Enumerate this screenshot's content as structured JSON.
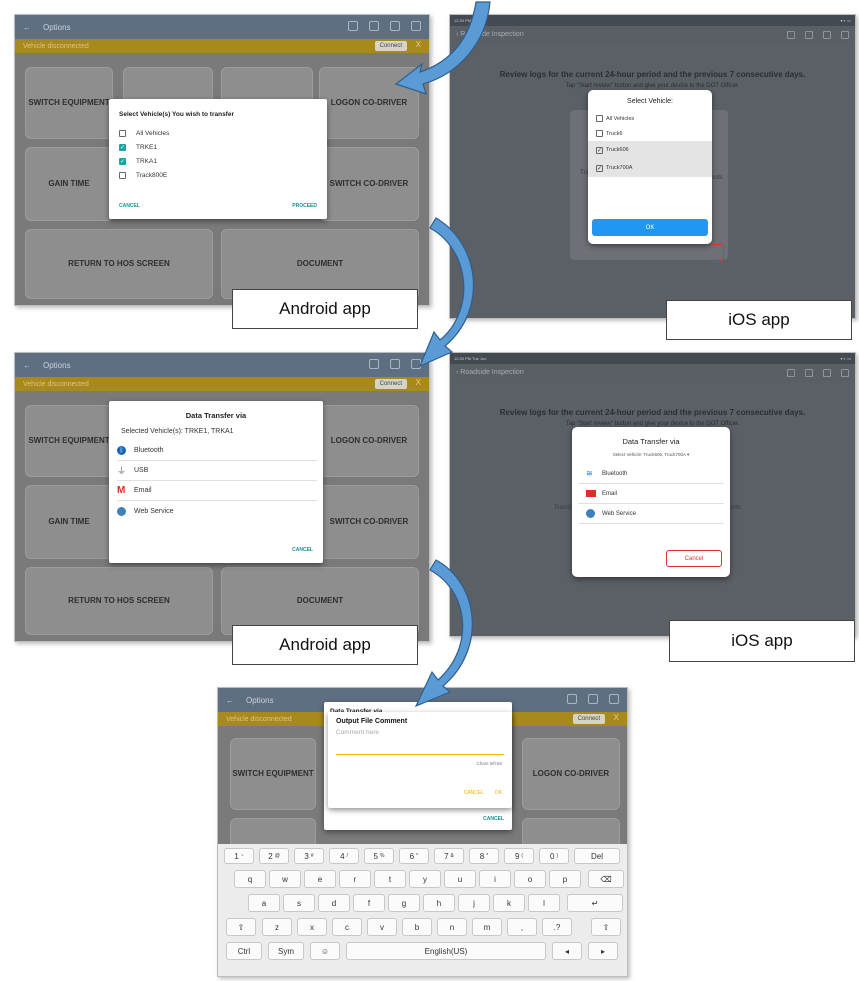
{
  "android": {
    "title": "Options",
    "disconnected": "Vehicle disconnected",
    "connect_label": "Connect",
    "close_x": "X",
    "tiles": {
      "switch_equipment": "SWITCH EQUIPMENT",
      "logon_codriver": "LOGON CO-DRIVER",
      "gain_time": "GAIN TIME",
      "switch_codriver": "SWITCH CO-DRIVER",
      "return_hos": "RETURN TO HOS SCREEN",
      "document": "DOCUMENT"
    },
    "select_dialog": {
      "title": "Select Vehicle(s) You wish to transfer",
      "items": [
        {
          "label": "All Vehicles",
          "checked": false
        },
        {
          "label": "TRKE1",
          "checked": true
        },
        {
          "label": "TRKA1",
          "checked": true
        },
        {
          "label": "Track800E",
          "checked": false
        }
      ],
      "cancel": "CANCEL",
      "proceed": "PROCEED"
    },
    "transfer_dialog": {
      "title": "Data Transfer via",
      "selected": "Selected Vehicle(s): TRKE1, TRKA1",
      "options": [
        {
          "label": "Bluetooth",
          "icon": "bluetooth-icon"
        },
        {
          "label": "USB",
          "icon": "usb-icon"
        },
        {
          "label": "Email",
          "icon": "email-icon"
        },
        {
          "label": "Web Service",
          "icon": "web-service-icon"
        }
      ],
      "cancel": "CANCEL"
    },
    "comment_dialog": {
      "header": "Data Transfer via",
      "title": "Output File Comment",
      "placeholder": "Comment here",
      "chars_left": "Chars left:60",
      "cancel": "CANCEL",
      "ok": "OK",
      "cancel2": "CANCEL"
    }
  },
  "ios": {
    "status_left": "12:30 PM  Tue Jun",
    "back_label": "Roadside Inspection",
    "review_text": "Review logs for the current 24-hour period and the previous 7 consecutive days.",
    "tap_text": "Tap \"Start review\" button and give your device to the DOT Officer.",
    "select_dialog": {
      "title": "Select Vehicle:",
      "items": [
        {
          "label": "All Vehicles",
          "checked": false
        },
        {
          "label": "Truck6",
          "checked": false
        },
        {
          "label": "Truck606",
          "checked": true
        },
        {
          "label": "Truck700A",
          "checked": true
        }
      ],
      "ok": "OK"
    },
    "transfer_dialog": {
      "title": "Data Transfer via",
      "selected": "Select Vehicle: Truck606, Truck700A",
      "options": [
        {
          "label": "Bluetooth",
          "icon": "wifi-icon"
        },
        {
          "label": "Email",
          "icon": "email-icon"
        },
        {
          "label": "Web Service",
          "icon": "web-service-icon"
        }
      ],
      "cancel": "Cancel"
    },
    "bg_fragments": {
      "transf": "Transf",
      "ords": "ords"
    }
  },
  "callouts": {
    "android1": "Android app",
    "ios1": "iOS app",
    "android2": "Android app",
    "ios2": "iOS app"
  },
  "keyboard": {
    "row1": [
      "1",
      "2",
      "3",
      "4",
      "5",
      "6",
      "7",
      "8",
      "9",
      "0",
      "Del"
    ],
    "row1_alt": [
      "~",
      "@",
      "#",
      "/",
      "%",
      "^",
      "&",
      "*",
      "(",
      ")",
      ""
    ],
    "row2": [
      "q",
      "w",
      "e",
      "r",
      "t",
      "y",
      "u",
      "i",
      "o",
      "p"
    ],
    "row3": [
      "a",
      "s",
      "d",
      "f",
      "g",
      "h",
      "j",
      "k",
      "l"
    ],
    "row4": [
      "z",
      "x",
      "c",
      "v",
      "b",
      "n",
      "m",
      ",",
      ".?"
    ],
    "row5": {
      "ctrl": "Ctrl",
      "sym": "Sym",
      "space": "English(US)"
    }
  }
}
